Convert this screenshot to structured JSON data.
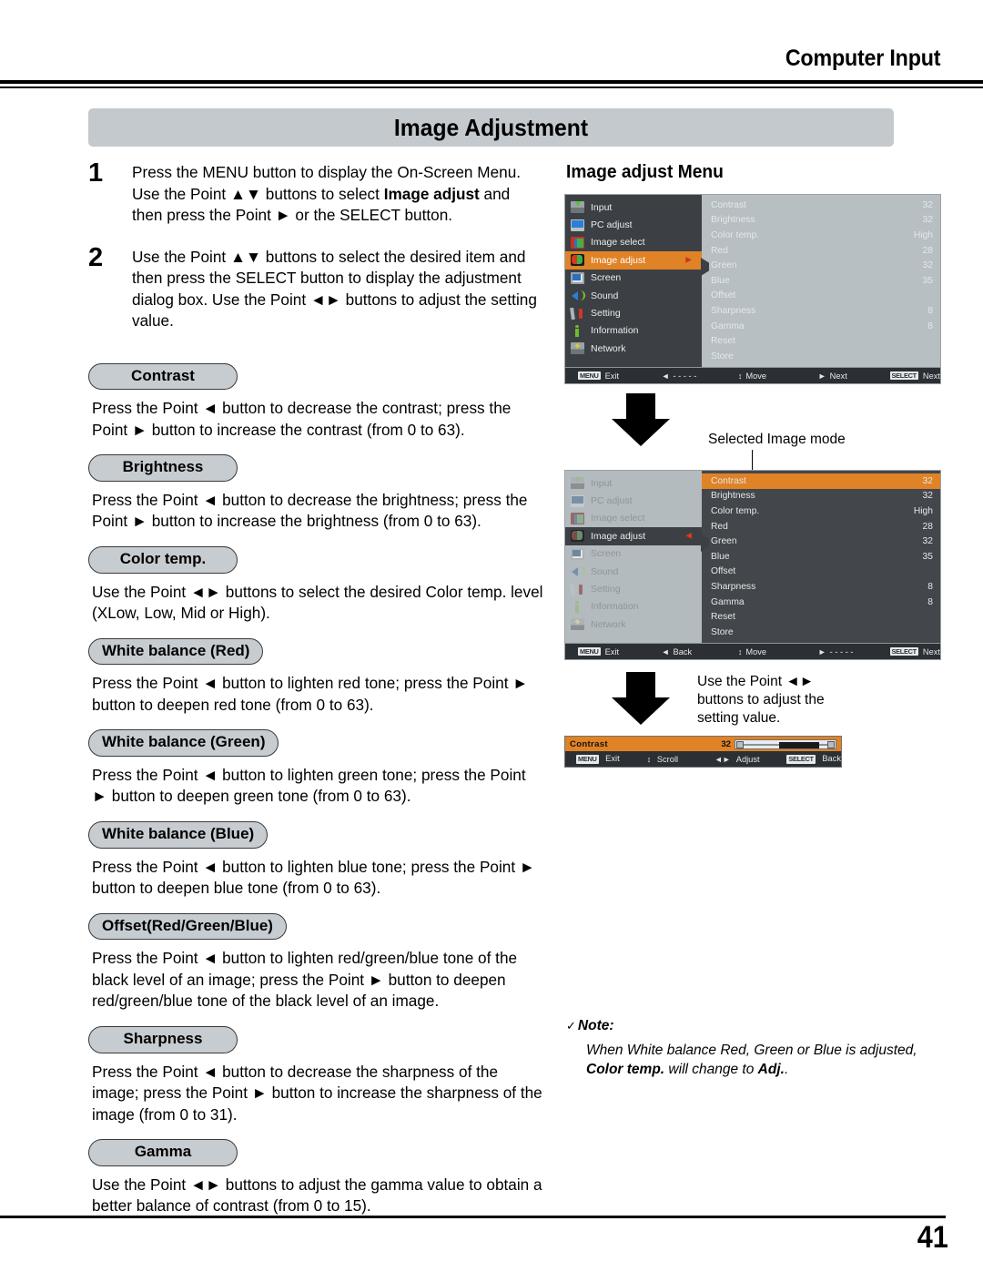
{
  "header": {
    "title": "Computer Input",
    "section_title": "Image Adjustment"
  },
  "steps": [
    {
      "number": "1",
      "text_before": "Press the MENU button to display the On-Screen Menu. Use the Point ▲▼ buttons to select ",
      "bold": "Image adjust",
      "text_after": " and then press the Point ► or the SELECT button."
    },
    {
      "number": "2",
      "text_before": "Use the Point ▲▼ buttons to select the desired item and then press the SELECT button to display the adjustment dialog box. Use the Point ◄► buttons to adjust the setting value.",
      "bold": "",
      "text_after": ""
    }
  ],
  "topics": [
    {
      "label": "Contrast",
      "body": "Press the Point ◄ button to decrease the contrast; press the Point ► button to increase the contrast (from 0 to 63)."
    },
    {
      "label": "Brightness",
      "body": "Press the Point ◄ button to decrease the brightness; press the Point ► button to increase the brightness (from 0 to 63)."
    },
    {
      "label": "Color temp.",
      "body": "Use the Point ◄► buttons to select the desired Color temp. level (XLow, Low, Mid or High)."
    },
    {
      "label": "White balance (Red)",
      "body": "Press the Point ◄ button to lighten red tone; press the Point ► button to deepen red tone (from 0 to 63)."
    },
    {
      "label": "White balance (Green)",
      "body": "Press the Point ◄ button to lighten green tone; press the Point ► button to deepen green tone (from 0 to 63)."
    },
    {
      "label": "White balance (Blue)",
      "body": "Press the Point ◄ button to lighten blue tone; press the Point ► button to deepen blue tone (from 0 to 63)."
    },
    {
      "label": "Offset(Red/Green/Blue)",
      "body": "Press the Point ◄ button to lighten red/green/blue tone of the black level of an image; press the Point ► button to deepen red/green/blue tone of the black level of an image."
    },
    {
      "label": "Sharpness",
      "body": "Press the Point ◄ button to decrease the sharpness of the image; press the Point ► button to increase the sharpness of the image (from 0 to 31)."
    },
    {
      "label": "Gamma",
      "body": "Use the Point ◄► buttons to adjust the gamma value to obtain a better balance of contrast (from 0 to 15)."
    }
  ],
  "right": {
    "title": "Image adjust Menu",
    "selected_image_mode_caption": "Selected Image mode",
    "adjust_caption": "Use the Point ◄► buttons to adjust the setting value."
  },
  "osd": {
    "sidebar": [
      {
        "label": "Input",
        "icon": "input-icon"
      },
      {
        "label": "PC adjust",
        "icon": "pc-adjust-icon"
      },
      {
        "label": "Image select",
        "icon": "image-select-icon"
      },
      {
        "label": "Image adjust",
        "icon": "image-adjust-icon"
      },
      {
        "label": "Screen",
        "icon": "screen-icon"
      },
      {
        "label": "Sound",
        "icon": "sound-icon"
      },
      {
        "label": "Setting",
        "icon": "setting-icon"
      },
      {
        "label": "Information",
        "icon": "information-icon"
      },
      {
        "label": "Network",
        "icon": "network-icon"
      }
    ],
    "active_sidebar_item": "Image adjust",
    "menu_rows": [
      {
        "label": "Contrast",
        "value": "32"
      },
      {
        "label": "Brightness",
        "value": "32"
      },
      {
        "label": "Color temp.",
        "value": "High"
      },
      {
        "label": "Red",
        "value": "28"
      },
      {
        "label": "Green",
        "value": "32"
      },
      {
        "label": "Blue",
        "value": "35"
      },
      {
        "label": "Offset",
        "value": ""
      },
      {
        "label": "Sharpness",
        "value": "8"
      },
      {
        "label": "Gamma",
        "value": "8"
      },
      {
        "label": "Reset",
        "value": ""
      },
      {
        "label": "Store",
        "value": ""
      }
    ],
    "selected_menu_row": "Contrast",
    "footer_top": {
      "exit_key": "MENU",
      "exit_label": "Exit",
      "left_glyph": "◄",
      "left_label": "- - - - -",
      "move_glyph": "↕",
      "move_label": "Move",
      "next_glyph": "►",
      "next_label": "Next",
      "select_key": "SELECT",
      "select_label": "Next"
    },
    "footer_bottom": {
      "exit_key": "MENU",
      "exit_label": "Exit",
      "left_glyph": "◄",
      "left_label": "Back",
      "move_glyph": "↕",
      "move_label": "Move",
      "next_glyph": "►",
      "next_label": "- - - - -",
      "select_key": "SELECT",
      "select_label": "Next"
    }
  },
  "dialog": {
    "name": "Contrast",
    "value": "32",
    "footer": {
      "exit_key": "MENU",
      "exit_label": "Exit",
      "scroll_glyph": "↕",
      "scroll_label": "Scroll",
      "adjust_glyph": "◄►",
      "adjust_label": "Adjust",
      "back_key": "SELECT",
      "back_label": "Back"
    }
  },
  "note": {
    "head_tick": "✓",
    "head": "Note:",
    "body_1": "When White balance Red, Green or Blue is adjusted, ",
    "body_bold_1": "Color temp.",
    "body_2": " will change to ",
    "body_bold_2": "Adj.",
    "body_3": "."
  },
  "footer": {
    "page_number": "41"
  },
  "colors": {
    "accent_orange": "#e08226",
    "banner_gray": "#c3c9cd",
    "pill_gray": "#c7ccd1",
    "osd_dark": "#3c4044",
    "osd_light": "#b7bfc2"
  }
}
